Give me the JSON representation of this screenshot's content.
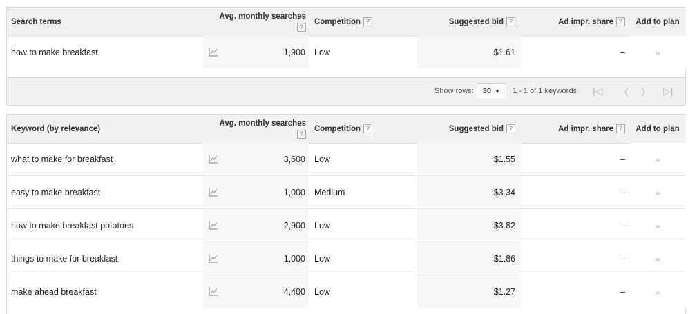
{
  "top_table": {
    "headers": {
      "term": "Search terms",
      "searches": "Avg. monthly searches",
      "competition": "Competition",
      "bid": "Suggested bid",
      "impr": "Ad impr. share",
      "add": "Add to plan"
    },
    "rows": [
      {
        "term": "how to make breakfast",
        "searches": "1,900",
        "competition": "Low",
        "bid": "$1.61",
        "impr": "–"
      }
    ]
  },
  "pager": {
    "show_rows_label": "Show rows:",
    "rows_value": "30",
    "range_text": "1 - 1 of 1 keywords"
  },
  "bottom_table": {
    "headers": {
      "term": "Keyword (by relevance)",
      "searches": "Avg. monthly searches",
      "competition": "Competition",
      "bid": "Suggested bid",
      "impr": "Ad impr. share",
      "add": "Add to plan"
    },
    "rows": [
      {
        "term": "what to make for breakfast",
        "searches": "3,600",
        "competition": "Low",
        "bid": "$1.55",
        "impr": "–"
      },
      {
        "term": "easy to make breakfast",
        "searches": "1,000",
        "competition": "Medium",
        "bid": "$3.34",
        "impr": "–"
      },
      {
        "term": "how to make breakfast potatoes",
        "searches": "2,900",
        "competition": "Low",
        "bid": "$3.82",
        "impr": "–"
      },
      {
        "term": "things to make for breakfast",
        "searches": "1,000",
        "competition": "Low",
        "bid": "$1.86",
        "impr": "–"
      },
      {
        "term": "make ahead breakfast",
        "searches": "4,400",
        "competition": "Low",
        "bid": "$1.27",
        "impr": "–"
      }
    ]
  },
  "icons": {
    "trend": "trend-chart-icon",
    "add": "add-to-plan-icon",
    "help": "help-icon"
  }
}
